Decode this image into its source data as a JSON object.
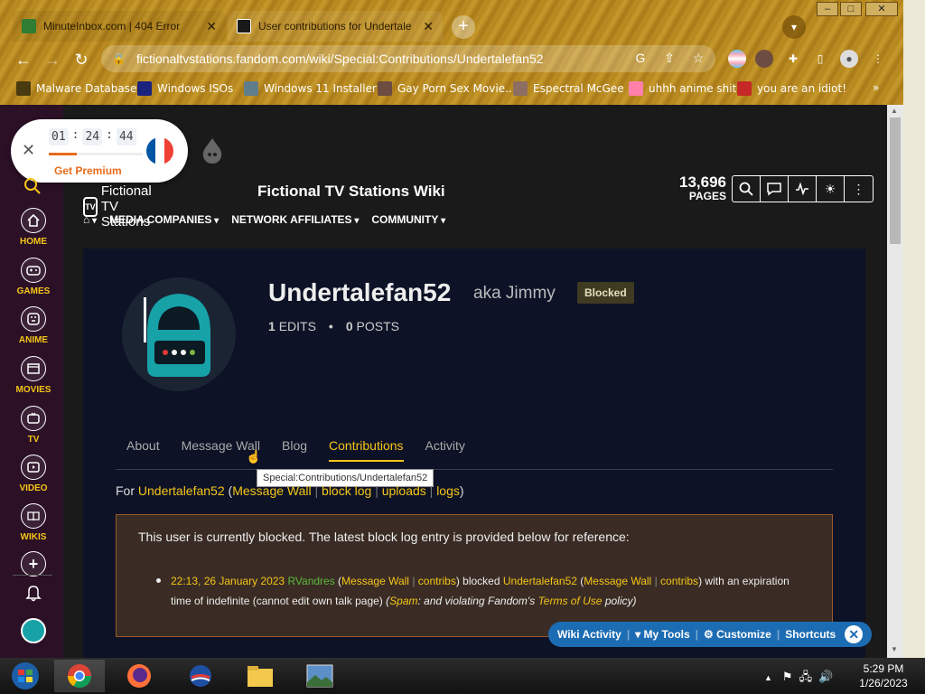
{
  "browser": {
    "tabs": [
      {
        "title": "MinuteInbox.com | 404 Error",
        "close": "✕"
      },
      {
        "title": "User contributions for Undertale",
        "close": "✕"
      }
    ],
    "new_tab": "+",
    "url": "fictionaltvstations.fandom.com/wiki/Special:Contributions/Undertalefan52",
    "bookmarks": [
      {
        "label": "Malware Database",
        "color": "#4a3a10"
      },
      {
        "label": "Windows ISOs",
        "color": "#1a237e"
      },
      {
        "label": "Windows 11 Installer",
        "color": "#607d8b"
      },
      {
        "label": "Gay Porn Sex Movie...",
        "color": "#6d4c41"
      },
      {
        "label": "Espectral McGee",
        "color": "#8d6e63"
      },
      {
        "label": "uhhh anime shit",
        "color": "#ff80ab"
      },
      {
        "label": "you are an idiot!",
        "color": "#c62828"
      }
    ],
    "bookmarks_more": "»"
  },
  "timer_widget": {
    "hours": "01",
    "minutes": "24",
    "seconds": "44",
    "premium": "Get Premium",
    "progress": 0.3
  },
  "rail": {
    "items": [
      {
        "label": "HOME",
        "icon": "home-icon"
      },
      {
        "label": "GAMES",
        "icon": "gamepad-icon"
      },
      {
        "label": "ANIME",
        "icon": "anime-icon"
      },
      {
        "label": "MOVIES",
        "icon": "film-icon"
      },
      {
        "label": "TV",
        "icon": "tv-icon"
      },
      {
        "label": "VIDEO",
        "icon": "video-icon"
      },
      {
        "label": "WIKIS",
        "icon": "book-icon"
      }
    ]
  },
  "wiki": {
    "logo_text": "Fictional TV Stations",
    "title": "Fictional TV Stations Wiki",
    "pages_count": "13,696",
    "pages_label": "PAGES",
    "nav": [
      "MEDIA COMPANIES",
      "NETWORK AFFILIATES",
      "COMMUNITY"
    ]
  },
  "profile": {
    "username": "Undertalefan52",
    "aka": "aka Jimmy",
    "badge": "Blocked",
    "edits_num": "1",
    "edits_label": "EDITS",
    "posts_num": "0",
    "posts_label": "POSTS",
    "tabs": [
      "About",
      "Message Wall",
      "Blog",
      "Contributions",
      "Activity"
    ],
    "tooltip": "Special:Contributions/Undertalefan52"
  },
  "for_line": {
    "prefix": "For",
    "user": "Undertalefan52",
    "links": [
      "Message Wall",
      "block log",
      "uploads",
      "logs"
    ]
  },
  "notice": {
    "heading": "This user is currently blocked. The latest block log entry is provided below for reference:",
    "timestamp": "22:13, 26 January 2023",
    "admin": "RVandres",
    "admin_wall": "Message Wall",
    "admin_contribs": "contribs",
    "action": "blocked",
    "target": "Undertalefan52",
    "target_wall": "Message Wall",
    "target_contribs": "contribs",
    "expiry": "with an expiration time of indefinite (cannot edit own talk page)",
    "reason_spam": "Spam",
    "reason_mid": ": and violating Fandom's",
    "reason_terms": "Terms of Use",
    "reason_end": "policy)"
  },
  "footer": {
    "items": [
      "Wiki Activity",
      "My Tools",
      "Customize",
      "Shortcuts"
    ]
  },
  "taskbar": {
    "time": "5:29 PM",
    "date": "1/26/2023"
  }
}
